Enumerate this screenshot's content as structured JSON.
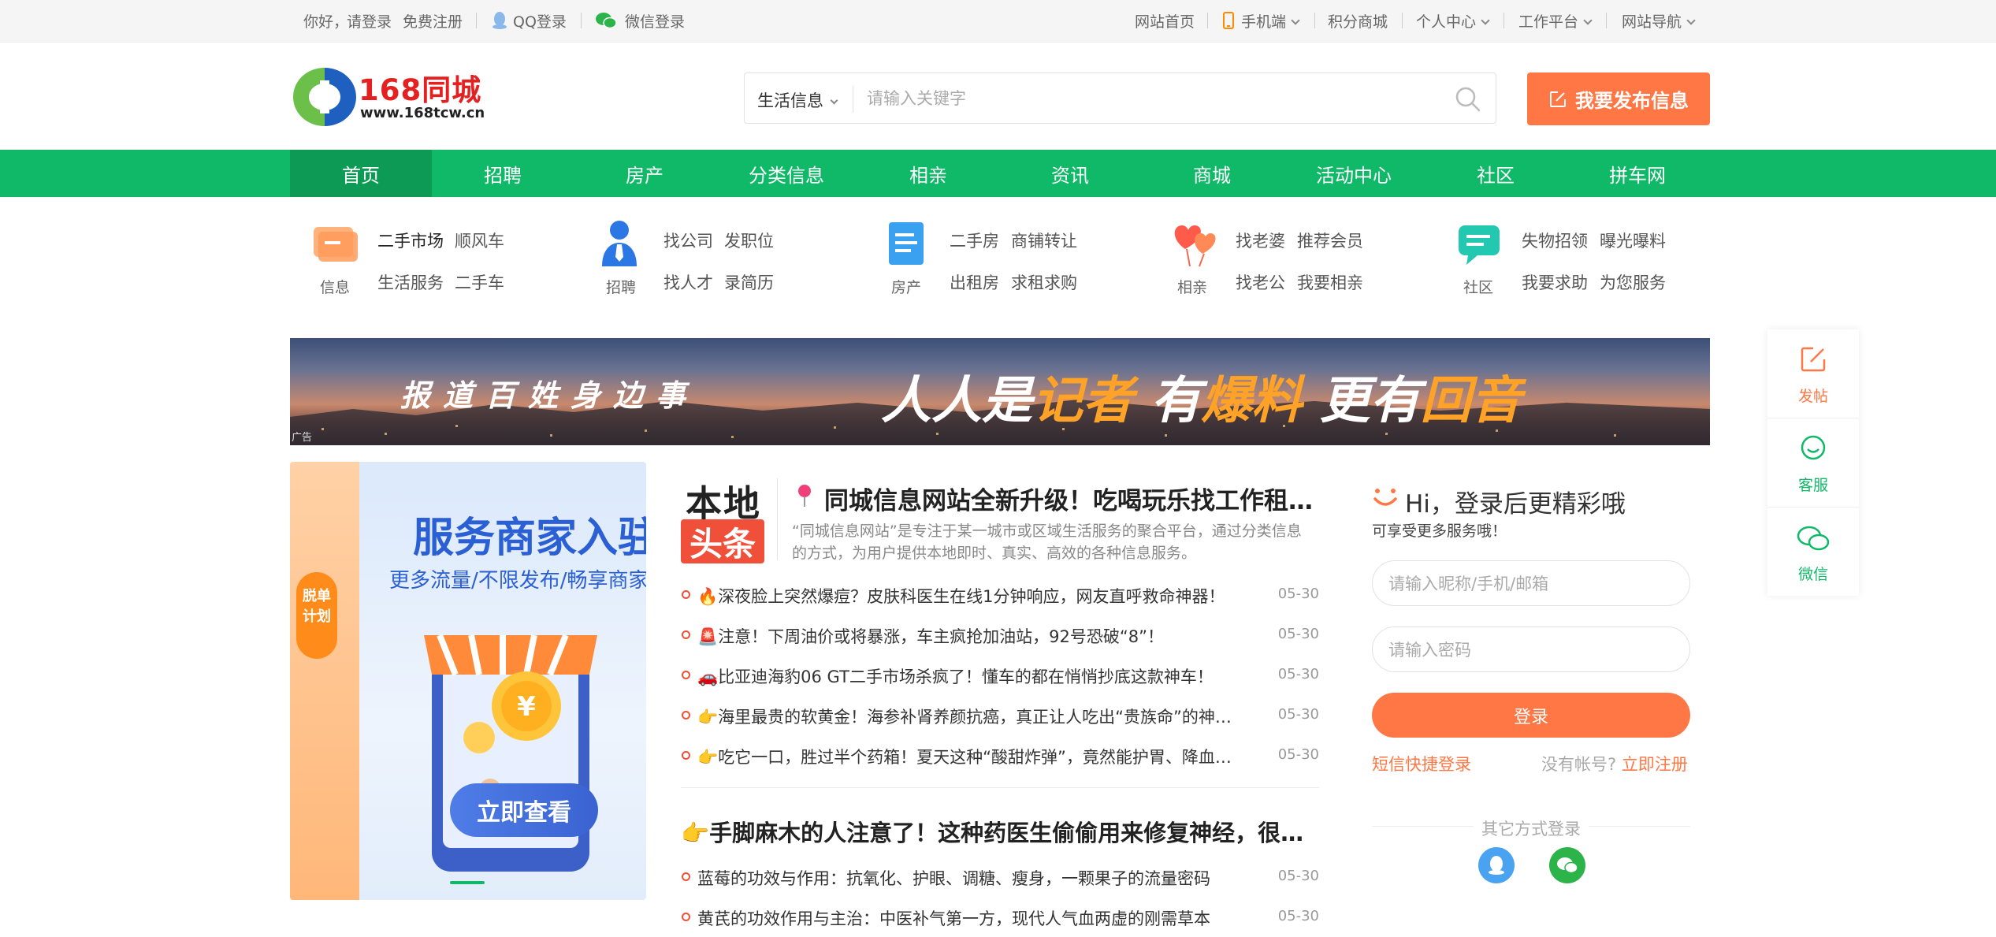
{
  "topbar": {
    "greeting": "你好，",
    "login": "请登录",
    "register": "免费注册",
    "qq_login": "QQ登录",
    "wechat_login": "微信登录",
    "site_home": "网站首页",
    "mobile": "手机端",
    "points_mall": "积分商城",
    "personal_center": "个人中心",
    "workbench": "工作平台",
    "site_nav": "网站导航"
  },
  "header": {
    "logo_text": "168同城",
    "logo_url": "www.168tcw.cn",
    "search_category": "生活信息",
    "search_placeholder": "请输入关键字",
    "publish_label": "我要发布信息"
  },
  "nav": {
    "items": [
      "首页",
      "招聘",
      "房产",
      "分类信息",
      "相亲",
      "资讯",
      "商城",
      "活动中心",
      "社区",
      "拼车网"
    ]
  },
  "quick": {
    "groups": [
      {
        "label": "信息",
        "links": [
          "二手市场",
          "顺风车",
          "生活服务",
          "二手车"
        ]
      },
      {
        "label": "招聘",
        "links": [
          "找公司",
          "发职位",
          "找人才",
          "录简历"
        ]
      },
      {
        "label": "房产",
        "links": [
          "二手房",
          "商铺转让",
          "出租房",
          "求租求购"
        ]
      },
      {
        "label": "相亲",
        "links": [
          "找老婆",
          "推荐会员",
          "找老公",
          "我要相亲"
        ]
      },
      {
        "label": "社区",
        "links": [
          "失物招领",
          "曝光曝料",
          "我要求助",
          "为您服务"
        ]
      }
    ]
  },
  "banner": {
    "left_text": "报道百姓身边事",
    "p1": "人人是",
    "o1": "记者",
    "p2": "有",
    "o2": "爆料",
    "p3": "更有",
    "o3": "回音",
    "ad_tag": "广告"
  },
  "promo": {
    "badge": "脱单计划",
    "title": "服务商家入驻",
    "subtitle": "更多流量/不限发布/畅享商家",
    "cta": "立即查看"
  },
  "news": {
    "logo_top": "本地",
    "logo_bottom": "头条",
    "headline": "同城信息网站全新升级！吃喝玩乐找工作租房买车",
    "summary": "“同城信息网站”是专注于某一城市或区域生活服务的聚合平台，通过分类信息的方式，为用户提供本地即时、真实、高效的各种信息服务。",
    "items": [
      {
        "emoji": "🔥",
        "text": "深夜脸上突然爆痘？皮肤科医生在线1分钟响应，网友直呼救命神器！",
        "date": "05-30"
      },
      {
        "emoji": "🚨",
        "text": "注意！下周油价或将暴涨，车主疯抢加油站，92号恐破“8”！",
        "date": "05-30"
      },
      {
        "emoji": "🚗",
        "text": "比亚迪海豹06 GT二手市场杀疯了！懂车的都在悄悄抄底这款神车！",
        "date": "05-30"
      },
      {
        "emoji": "👉",
        "text": "海里最贵的软黄金！海参补肾养颜抗癌，真正让人吃出“贵族命”的神物！",
        "date": "05-30"
      },
      {
        "emoji": "👉",
        "text": "吃它一口，胜过半个药箱！夏天这种“酸甜炸弹”，竟然能护胃、降血糖、抗衰老！",
        "date": "05-30"
      }
    ],
    "headline2": "👉手脚麻木的人注意了！这种药医生偷偷用来修复神经，很多人都不知道",
    "items2": [
      {
        "text": "蓝莓的功效与作用：抗氧化、护眼、调糖、瘦身，一颗果子的流量密码",
        "date": "05-30"
      },
      {
        "text": "黄芪的功效作用与主治：中医补气第一方，现代人气血两虚的刚需草本",
        "date": "05-30"
      }
    ]
  },
  "login": {
    "title": "Hi，登录后更精彩哦",
    "subtitle": "可享受更多服务哦！",
    "username_placeholder": "请输入昵称/手机/邮箱",
    "password_placeholder": "请输入密码",
    "login_button": "登录",
    "sms_login": "短信快捷登录",
    "no_account": "没有帐号?",
    "register_now": "立即注册",
    "other_methods": "其它方式登录"
  },
  "side": {
    "post": "发帖",
    "service": "客服",
    "wechat": "微信"
  },
  "colors": {
    "brand_green": "#10b968",
    "accent_orange": "#ff7744",
    "news_red": "#f04f3a"
  }
}
